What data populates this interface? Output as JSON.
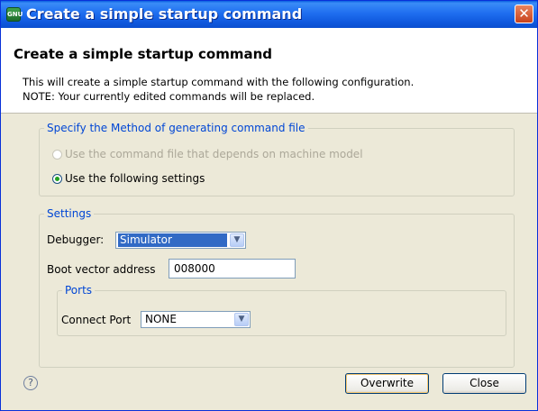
{
  "window": {
    "title": "Create a simple startup command",
    "app_icon_text": "GNU"
  },
  "header": {
    "title": "Create a simple startup command",
    "description_line1": "This will create a simple startup command with the following configuration.",
    "description_line2": "NOTE: Your currently edited commands will be replaced."
  },
  "method_group": {
    "legend": "Specify the Method of generating command file",
    "options": [
      {
        "label": "Use the command file that depends on machine model",
        "selected": false,
        "enabled": false
      },
      {
        "label": "Use the following settings",
        "selected": true,
        "enabled": true
      }
    ]
  },
  "settings_group": {
    "legend": "Settings",
    "debugger_label": "Debugger:",
    "debugger_value": "Simulator",
    "boot_vector_label": "Boot vector address",
    "boot_vector_value": "008000"
  },
  "ports_group": {
    "legend": "Ports",
    "connect_port_label": "Connect Port",
    "connect_port_value": "NONE"
  },
  "buttons": {
    "overwrite": "Overwrite",
    "close": "Close"
  },
  "icons": {
    "help": "help-icon",
    "close_window": "close-icon",
    "dropdown": "chevron-down-icon"
  }
}
